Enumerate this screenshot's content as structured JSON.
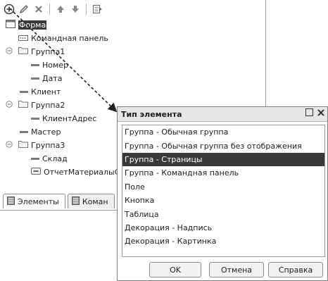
{
  "toolbar": {
    "icons": [
      "add-icon",
      "edit-icon",
      "delete-icon",
      "move-up-icon",
      "move-down-icon",
      "properties-icon"
    ]
  },
  "tree": {
    "items": [
      {
        "label": "Форма",
        "kind": "form",
        "selected": true
      },
      {
        "label": "Командная панель",
        "kind": "command-panel"
      },
      {
        "label": "Группа1",
        "kind": "group",
        "expanded": true
      },
      {
        "label": "Номер",
        "kind": "field"
      },
      {
        "label": "Дата",
        "kind": "field"
      },
      {
        "label": "Клиент",
        "kind": "field"
      },
      {
        "label": "Группа2",
        "kind": "group",
        "expanded": true
      },
      {
        "label": "КлиентАдрес",
        "kind": "field"
      },
      {
        "label": "Мастер",
        "kind": "field"
      },
      {
        "label": "Группа3",
        "kind": "group",
        "expanded": true
      },
      {
        "label": "Склад",
        "kind": "field"
      },
      {
        "label": "ОтчетМатериалыС",
        "kind": "button"
      }
    ]
  },
  "tabs": [
    {
      "label": "Элементы",
      "active": true
    },
    {
      "label": "Коман",
      "active": false
    }
  ],
  "dialog": {
    "title": "Тип элемента",
    "items": [
      "Группа - Обычная группа",
      "Группа - Обычная группа без отображения",
      "Группа - Страницы",
      "Группа - Командная панель",
      "Поле",
      "Кнопка",
      "Таблица",
      "Декорация - Надпись",
      "Декорация - Картинка"
    ],
    "selected_index": 2,
    "buttons": {
      "ok": "OK",
      "cancel": "Отмена",
      "help": "Справка"
    },
    "button_ok_label": "OK"
  },
  "colors": {
    "selection": "#3a3a3a",
    "panel_border": "#9a9a9a",
    "title_bar": "#e6e6e6"
  }
}
